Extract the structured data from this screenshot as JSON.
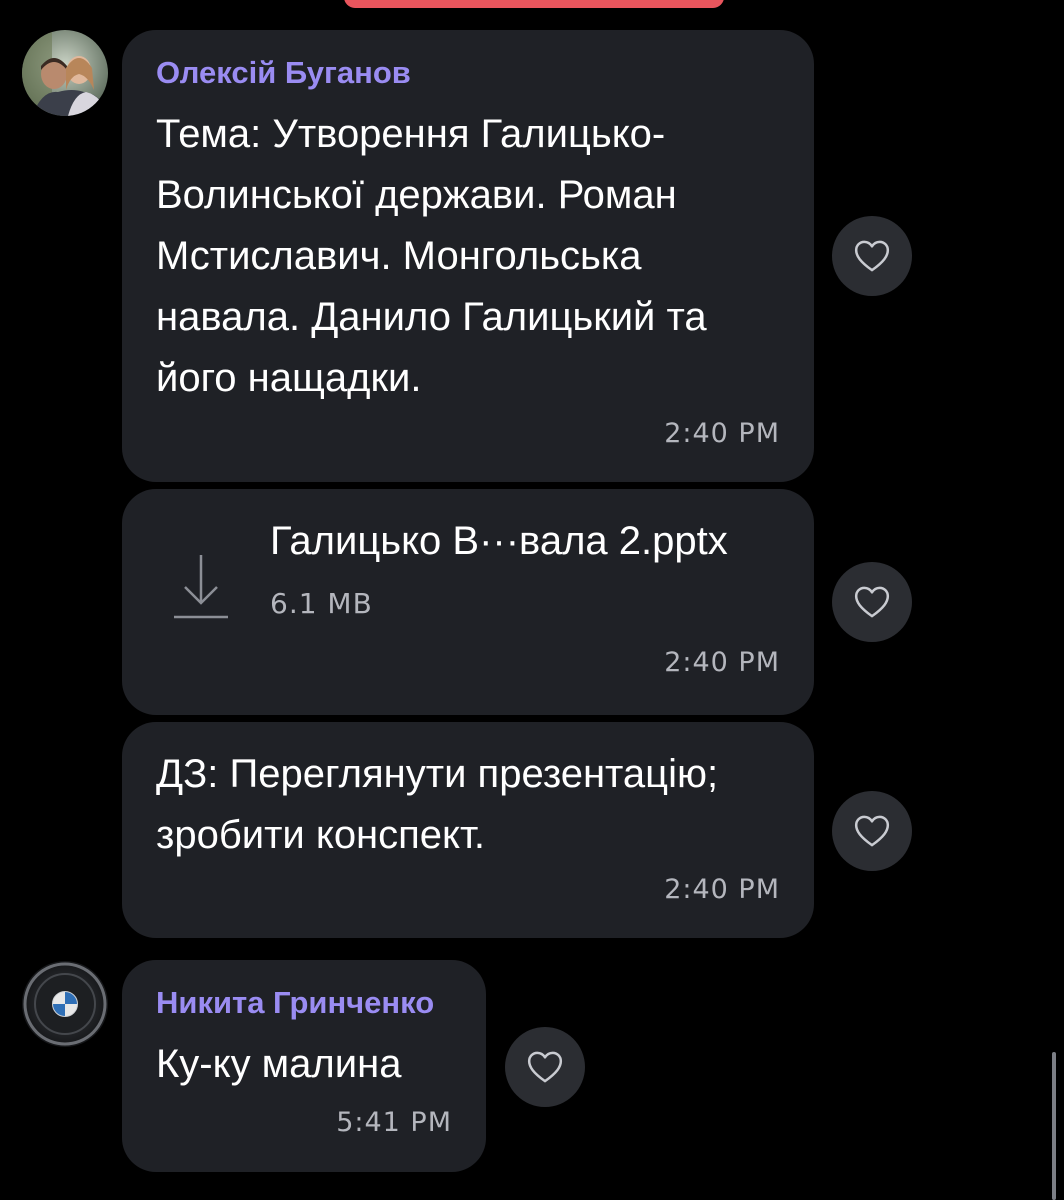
{
  "chat": {
    "messages": [
      {
        "sender": "Олексій Буганов",
        "text": "Тема: Утворення Галицько-Волинської держави. Роман Мстиславич. Монгольська навала. Данило Галицький та його нащадки.",
        "time": "2:40 PM"
      },
      {
        "file": {
          "name": "Галицько В···вала 2.pptx",
          "size": "6.1 MB",
          "icon": "download-icon"
        },
        "time": "2:40 PM"
      },
      {
        "text": "ДЗ: Переглянути презентацію; зробити конспект.",
        "time": "2:40 PM"
      },
      {
        "sender": "Никита Гринченко",
        "text": "Ку-ку малина",
        "time": "5:41 PM"
      }
    ]
  },
  "icons": {
    "reaction": "heart-icon",
    "file": "download-icon"
  },
  "colors": {
    "background": "#000000",
    "bubble": "#1f2126",
    "sender_name": "#9a8cf2",
    "timestamp": "#b4b6bd",
    "reaction_button": "#2b2d32",
    "top_pill": "#e9555d"
  }
}
